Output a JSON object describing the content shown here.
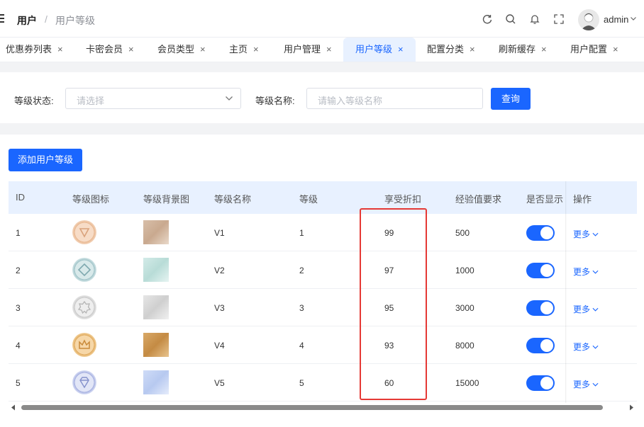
{
  "header": {
    "breadcrumb": [
      "用户",
      "用户等级"
    ],
    "separator": "/",
    "username": "admin"
  },
  "tabs": [
    {
      "label": "优惠券列表",
      "active": false
    },
    {
      "label": "卡密会员",
      "active": false
    },
    {
      "label": "会员类型",
      "active": false
    },
    {
      "label": "主页",
      "active": false
    },
    {
      "label": "用户管理",
      "active": false
    },
    {
      "label": "用户等级",
      "active": true
    },
    {
      "label": "配置分类",
      "active": false
    },
    {
      "label": "刷新缓存",
      "active": false
    },
    {
      "label": "用户配置",
      "active": false
    }
  ],
  "tab_close": "×",
  "filter": {
    "status_label": "等级状态:",
    "status_placeholder": "请选择",
    "name_label": "等级名称:",
    "name_placeholder": "请输入等级名称",
    "query_button": "查询"
  },
  "add_button": "添加用户等级",
  "table": {
    "columns": [
      "ID",
      "等级图标",
      "等级背景图",
      "等级名称",
      "等级",
      "享受折扣",
      "经验值要求",
      "是否显示",
      "操作"
    ],
    "rows": [
      {
        "id": "1",
        "name": "V1",
        "level": "1",
        "discount": "99",
        "exp": "500",
        "visible": true,
        "action": "更多"
      },
      {
        "id": "2",
        "name": "V2",
        "level": "2",
        "discount": "97",
        "exp": "1000",
        "visible": true,
        "action": "更多"
      },
      {
        "id": "3",
        "name": "V3",
        "level": "3",
        "discount": "95",
        "exp": "3000",
        "visible": true,
        "action": "更多"
      },
      {
        "id": "4",
        "name": "V4",
        "level": "4",
        "discount": "93",
        "exp": "8000",
        "visible": true,
        "action": "更多"
      },
      {
        "id": "5",
        "name": "V5",
        "level": "5",
        "discount": "60",
        "exp": "15000",
        "visible": true,
        "action": "更多"
      }
    ]
  },
  "colors": {
    "primary": "#1a66ff",
    "highlight_box": "#e53935",
    "header_bg": "#e8f1ff"
  }
}
